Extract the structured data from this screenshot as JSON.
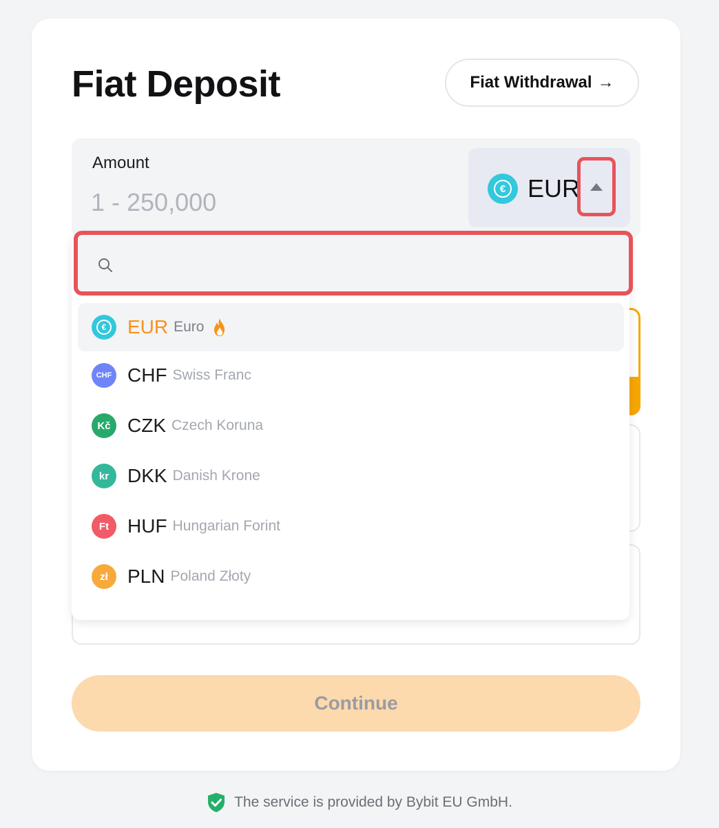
{
  "header": {
    "title": "Fiat Deposit",
    "withdraw_label": "Fiat Withdrawal",
    "withdraw_arrow": "→"
  },
  "amount": {
    "label": "Amount",
    "placeholder": "1 - 250,000",
    "value": ""
  },
  "currency_select": {
    "selected_code": "EUR",
    "selected_symbol": "€",
    "expanded": true,
    "icon": "caret-up-icon"
  },
  "search": {
    "placeholder": "",
    "value": ""
  },
  "currencies": [
    {
      "code": "EUR",
      "name": "Euro",
      "symbol": "€",
      "color": "#33c8dc",
      "selected": true,
      "hot": true
    },
    {
      "code": "CHF",
      "name": "Swiss Franc",
      "symbol": "CHF",
      "color": "#6f84f6",
      "selected": false,
      "hot": false
    },
    {
      "code": "CZK",
      "name": "Czech Koruna",
      "symbol": "Kč",
      "color": "#27a96b",
      "selected": false,
      "hot": false
    },
    {
      "code": "DKK",
      "name": "Danish Krone",
      "symbol": "kr",
      "color": "#33b89b",
      "selected": false,
      "hot": false
    },
    {
      "code": "HUF",
      "name": "Hungarian Forint",
      "symbol": "Ft",
      "color": "#f05b67",
      "selected": false,
      "hot": false
    },
    {
      "code": "PLN",
      "name": "Poland Złoty",
      "symbol": "zł",
      "color": "#f7a93a",
      "selected": false,
      "hot": false
    }
  ],
  "continue_label": "Continue",
  "footer": {
    "text": "The service is provided by Bybit EU GmbH.",
    "icon": "shield-check-icon"
  },
  "colors": {
    "accent": "#f7a600",
    "highlight": "#e8535a",
    "continue_disabled": "#fdd9ae"
  }
}
